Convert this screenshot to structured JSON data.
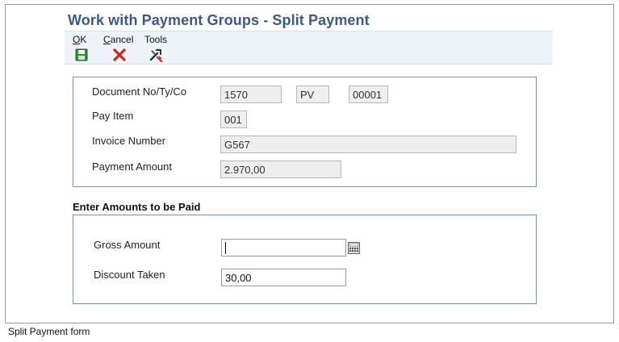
{
  "form": {
    "title": "Work with Payment Groups - Split Payment"
  },
  "toolbar": {
    "ok": {
      "label": "OK",
      "underline": "O",
      "rest": "K",
      "icon": "save-icon"
    },
    "cancel": {
      "label": "Cancel",
      "underline": "C",
      "rest": "ancel",
      "icon": "close-icon"
    },
    "tools": {
      "label": "Tools",
      "icon": "tools-icon"
    }
  },
  "document": {
    "doc_no_label": "Document No/Ty/Co",
    "doc_no": "1570",
    "doc_type": "PV",
    "doc_company": "00001",
    "pay_item_label": "Pay Item",
    "pay_item": "001",
    "invoice_label": "Invoice Number",
    "invoice": "G567",
    "payment_amount_label": "Payment Amount",
    "payment_amount": "2.970,00"
  },
  "amounts": {
    "heading": "Enter Amounts to be Paid",
    "gross_label": "Gross Amount",
    "gross_value": "",
    "calculator_icon": "calculator-icon",
    "discount_label": "Discount Taken",
    "discount_value": "30,00"
  },
  "caption": "Split Payment form",
  "colors": {
    "title": "#3a5a8c",
    "toolbar_bg": "#eef3fa",
    "panel_border": "#7d8fae",
    "readonly_bg": "#eeeeee"
  }
}
